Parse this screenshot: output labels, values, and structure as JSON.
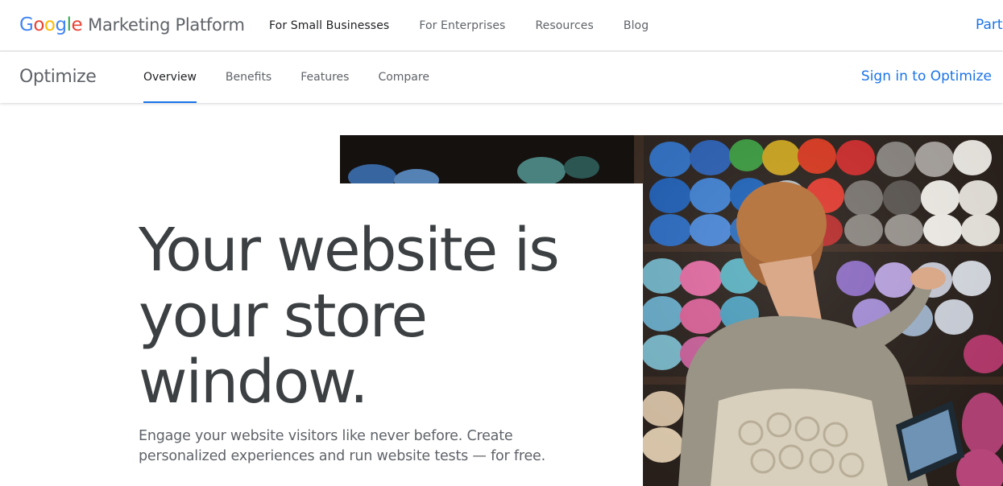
{
  "brand": {
    "google_letters": [
      {
        "char": "G",
        "color": "#4285F4"
      },
      {
        "char": "o",
        "color": "#EA4335"
      },
      {
        "char": "o",
        "color": "#FBBC05"
      },
      {
        "char": "g",
        "color": "#4285F4"
      },
      {
        "char": "l",
        "color": "#34A853"
      },
      {
        "char": "e",
        "color": "#EA4335"
      }
    ],
    "platform": "Marketing Platform"
  },
  "topnav": {
    "items": [
      {
        "label": "For Small Businesses",
        "active": true
      },
      {
        "label": "For Enterprises",
        "active": false
      },
      {
        "label": "Resources",
        "active": false
      },
      {
        "label": "Blog",
        "active": false
      }
    ],
    "partner_label": "Part"
  },
  "subnav": {
    "product": "Optimize",
    "items": [
      {
        "label": "Overview",
        "active": true
      },
      {
        "label": "Benefits",
        "active": false
      },
      {
        "label": "Features",
        "active": false
      },
      {
        "label": "Compare",
        "active": false
      }
    ],
    "signin_label": "Sign in to Optimize"
  },
  "hero": {
    "headline_lines": [
      "Your website is",
      "your store",
      "window."
    ],
    "subtext": "Engage your website visitors like never before. Create personalized experiences and run website tests — for free.",
    "image_icon": "yarn-store-photo"
  },
  "colors": {
    "accent": "#1a73e8",
    "heading": "#3c4043",
    "body": "#5f6368"
  }
}
